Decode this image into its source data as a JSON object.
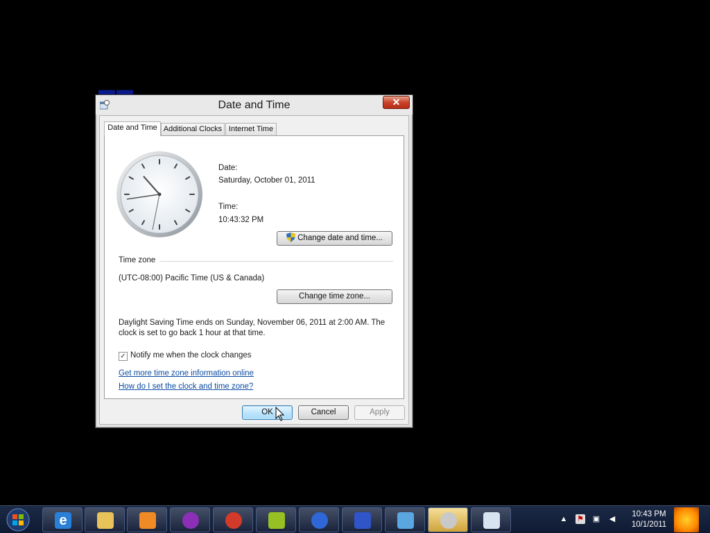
{
  "window": {
    "title": "Date and Time",
    "close_glyph": "✕"
  },
  "tabs": [
    {
      "label": "Date and Time",
      "active": true
    },
    {
      "label": "Additional Clocks",
      "active": false
    },
    {
      "label": "Internet Time",
      "active": false
    }
  ],
  "datetime": {
    "date_label": "Date:",
    "date_value": "Saturday, October 01, 2011",
    "time_label": "Time:",
    "time_value": "10:43:32 PM",
    "change_button": "Change date and time..."
  },
  "timezone": {
    "section_label": "Time zone",
    "value": "(UTC-08:00) Pacific Time (US & Canada)",
    "change_button": "Change time zone..."
  },
  "dst": {
    "line1": "Daylight Saving Time ends on Sunday, November 06, 2011 at 2:00 AM. The",
    "line2": "clock is set to go back 1 hour at that time."
  },
  "notify": {
    "label": "Notify me when the clock changes",
    "checked": true
  },
  "links": {
    "more_info": "Get more time zone information online",
    "how_to": "How do I set the clock and time zone?"
  },
  "footer": {
    "ok": "OK",
    "cancel": "Cancel",
    "apply": "Apply"
  },
  "taskbar": {
    "apps": [
      "internet-explorer-icon",
      "windows-explorer-icon",
      "media-player-icon",
      "purple-app-icon",
      "maps-app-icon",
      "android-icon",
      "firefox-icon",
      "blue-app-icon",
      "control-panel-icon",
      "speaker-app-icon",
      "date-time-app-icon"
    ],
    "tray_time": "10:43 PM",
    "tray_date": "10/1/2011"
  }
}
